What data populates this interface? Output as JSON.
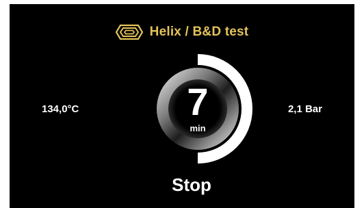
{
  "header": {
    "title": "Helix / B&D test",
    "logo_icon": "helix-hexagon-icon"
  },
  "readouts": {
    "temperature": "134,0°C",
    "pressure": "2,1 Bar"
  },
  "timer": {
    "value": "7",
    "unit": "min",
    "progress": 0.5
  },
  "actions": {
    "stop_label": "Stop"
  },
  "colors": {
    "background": "#000000",
    "accent_gold": "#e3c35a",
    "text": "#ffffff",
    "progress_arc": "#ffffff"
  }
}
